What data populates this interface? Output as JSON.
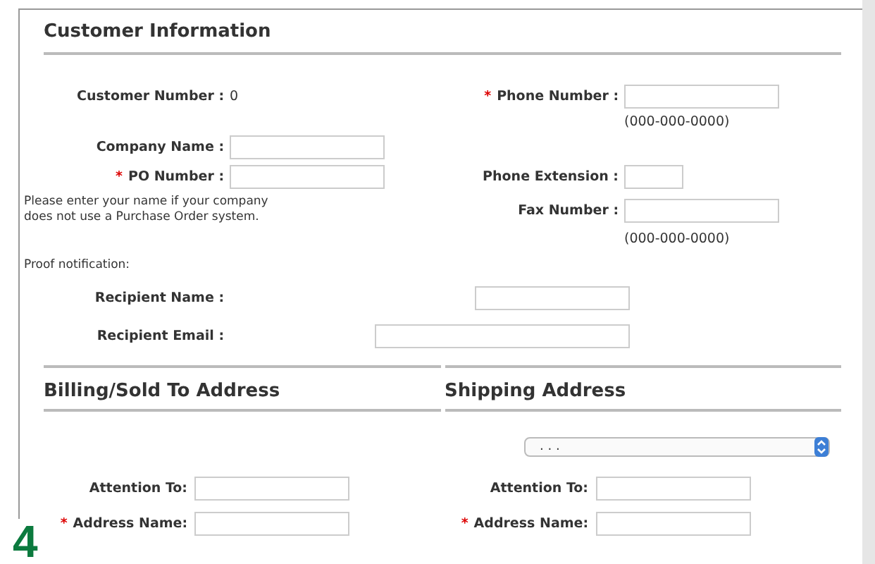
{
  "customer_information": {
    "title": "Customer Information",
    "rows": [
      {
        "left": {
          "kind": "value",
          "label": "Customer Number :",
          "value": "0"
        },
        "right": {
          "kind": "input",
          "mark": "*",
          "label": "Phone Number :"
        }
      },
      {
        "right": {
          "kind": "hint",
          "text": "(000-000-0000)"
        }
      },
      {
        "left": {
          "kind": "input",
          "label": "Company Name :"
        }
      },
      {
        "left": {
          "kind": "input",
          "mark": "*",
          "label": "PO Number :"
        },
        "right": {
          "kind": "short_input",
          "label": "Phone Extension :"
        }
      },
      {
        "left": {
          "kind": "note",
          "text": "Please enter your name if your company does not use a Purchase Order system."
        },
        "right": {
          "kind": "input",
          "label": "Fax Number :"
        }
      },
      {
        "right": {
          "kind": "hint",
          "text": "(000-000-0000)"
        }
      }
    ],
    "proof": {
      "title": "Proof notification:",
      "recipients": [
        {
          "label": "Recipient Name :"
        },
        {
          "label": "Recipient Email :"
        }
      ]
    }
  },
  "addresses": [
    {
      "title": "Billing/Sold To Address",
      "fields": [
        {
          "label": "Attention To:"
        },
        {
          "mark": "*",
          "label": "Address Name:"
        }
      ]
    },
    {
      "title": "Shipping Address",
      "select": {
        "value": ". . ."
      },
      "fields": [
        {
          "label": "Attention To:"
        },
        {
          "mark": "*",
          "label": "Address Name:"
        }
      ]
    }
  ],
  "step_number": "4"
}
